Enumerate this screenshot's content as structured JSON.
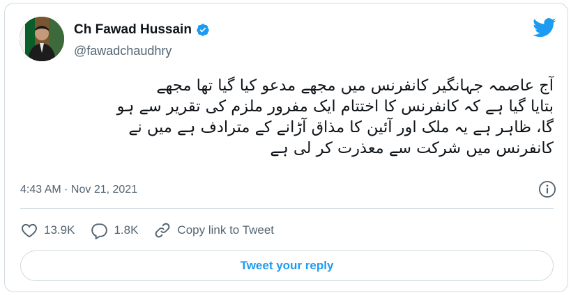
{
  "author": {
    "name": "Ch Fawad Hussain",
    "handle": "@fawadchaudhry",
    "verified": true
  },
  "tweet": {
    "text": "آج عاصمہ جہانگیر کانفرنس میں مجھے مدعو کیا گیا تھا مجھے\nبتایا گیا ہے کہ کانفرنس کا اختتام ایک مفرور ملزم کی تقریر سے ہو\nگا، ظاہر ہے یہ ملک اور آئین کا مذاق آڑانے کے مترادف ہے میں نے\nکانفرنس میں شرکت سے معذرت کر لی ہے",
    "timestamp": "4:43 AM · Nov 21, 2021"
  },
  "actions": {
    "likes": "13.9K",
    "replies": "1.8K",
    "copy_link": "Copy link to Tweet"
  },
  "reply_button": "Tweet your reply",
  "icons": {
    "bird": "twitter-bird-icon",
    "verified": "verified-badge-icon",
    "info": "info-icon",
    "like": "heart-icon",
    "reply": "reply-bubble-icon",
    "link": "link-icon"
  },
  "colors": {
    "accent": "#1d9bf0",
    "secondary_text": "#536471",
    "border": "#cfd9de"
  }
}
